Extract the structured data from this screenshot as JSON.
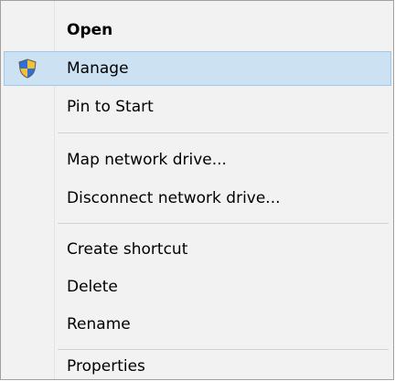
{
  "menu": {
    "items": [
      {
        "label": "Open",
        "bold": true
      },
      {
        "label": "Manage",
        "highlighted": true,
        "icon": "uac-shield-icon"
      },
      {
        "label": "Pin to Start"
      },
      {
        "label": "Map network drive..."
      },
      {
        "label": "Disconnect network drive..."
      },
      {
        "label": "Create shortcut"
      },
      {
        "label": "Delete"
      },
      {
        "label": "Rename"
      },
      {
        "label": "Properties"
      }
    ]
  },
  "colors": {
    "menu_background": "#f2f2f2",
    "highlight_background": "#cce2f3",
    "highlight_border": "#a3c7e8",
    "separator": "#d2d2d2"
  }
}
